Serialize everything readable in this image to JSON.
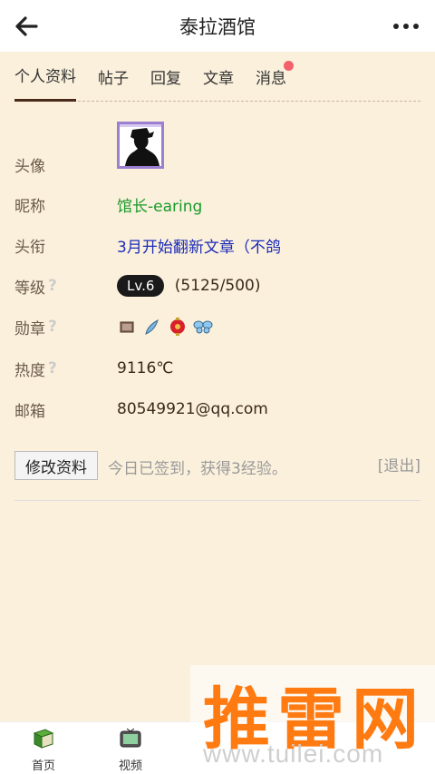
{
  "header": {
    "title": "泰拉酒馆"
  },
  "tabs": [
    {
      "label": "个人资料"
    },
    {
      "label": "帖子"
    },
    {
      "label": "回复"
    },
    {
      "label": "文章"
    },
    {
      "label": "消息"
    }
  ],
  "profile": {
    "avatar_label": "头像",
    "nickname_label": "昵称",
    "nickname": "馆长-earing",
    "title_label": "头衔",
    "title": "3月开始翻新文章（不鸽",
    "level_label": "等级",
    "level_badge": "Lv.6",
    "level_progress": "(5125/500)",
    "medals_label": "勋章",
    "heat_label": "热度",
    "heat": "9116℃",
    "email_label": "邮箱",
    "email": "80549921@qq.com",
    "help_icon_name": "question-icon"
  },
  "actions": {
    "edit_label": "修改资料",
    "checkin_text": "今日已签到，获得3经验。",
    "logout_label": "[退出]"
  },
  "bottom_nav": [
    {
      "label": "首页",
      "icon": "book-icon"
    },
    {
      "label": "视频",
      "icon": "tv-icon"
    }
  ],
  "watermark": {
    "text": "推雷网",
    "url": "www.tuilei.com"
  },
  "colors": {
    "background": "#fbf0dc",
    "nickname": "#1a9a2a",
    "title": "#1b2bb8",
    "badge_dot": "#f2606a",
    "watermark": "#ff7a10"
  }
}
